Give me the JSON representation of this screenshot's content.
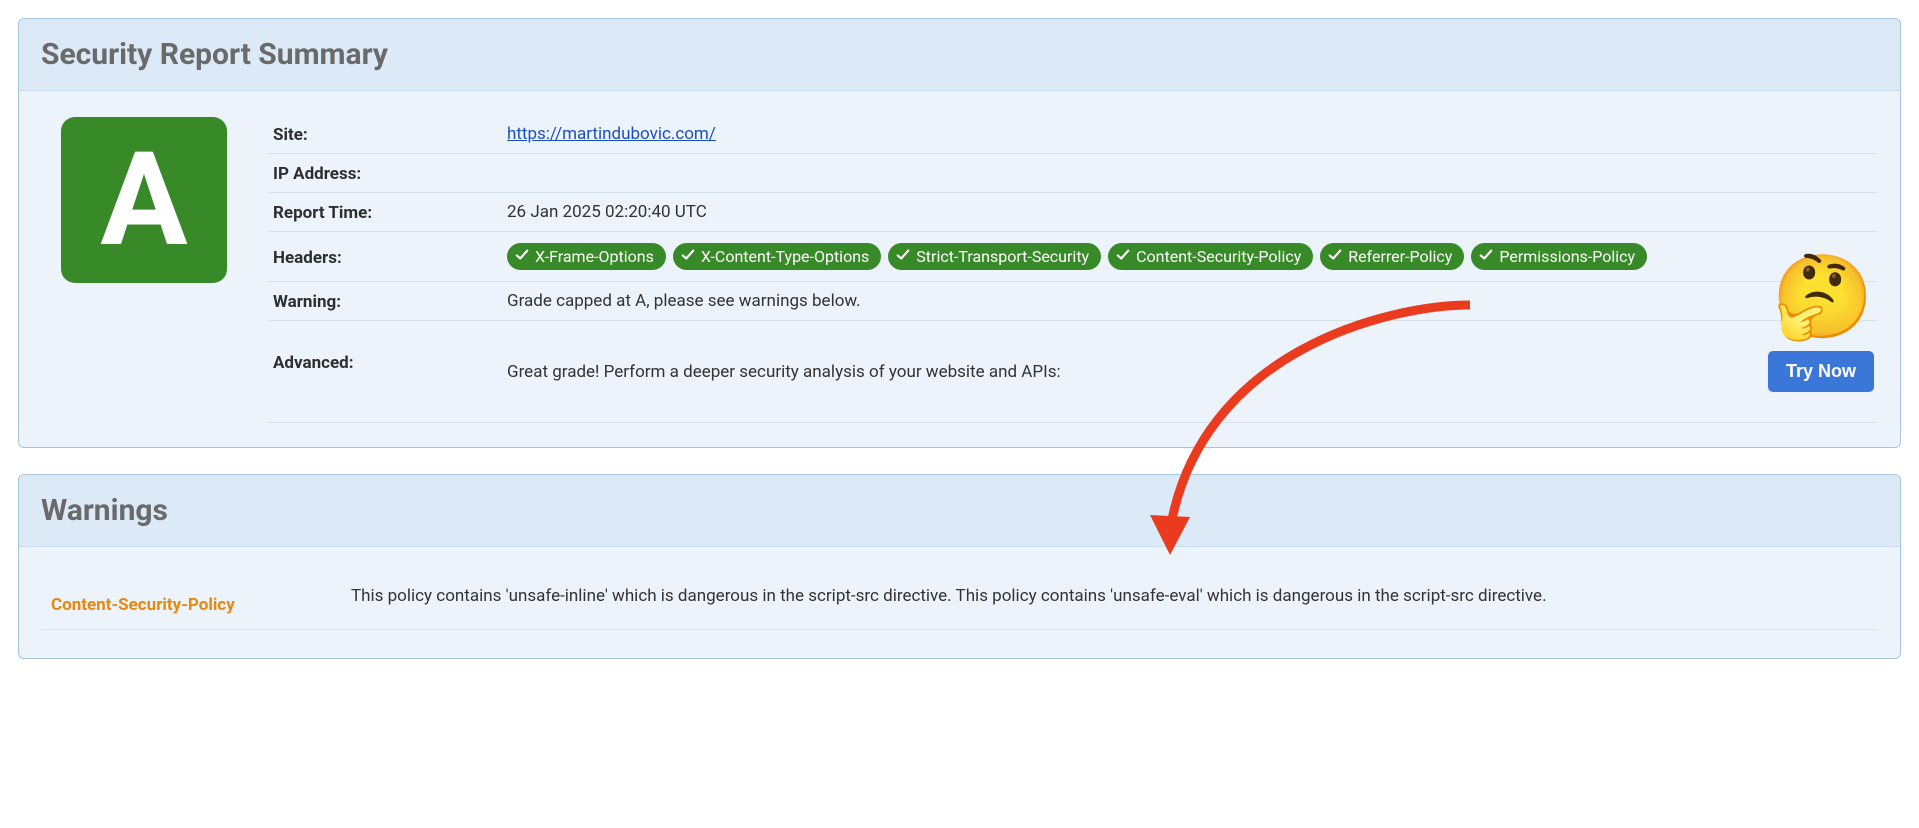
{
  "summary": {
    "title": "Security Report Summary",
    "grade": "A",
    "rows": {
      "site_label": "Site:",
      "site_url": "https://martindubovic.com/",
      "ip_label": "IP Address:",
      "ip_value": "",
      "report_time_label": "Report Time:",
      "report_time_value": "26 Jan 2025 02:20:40 UTC",
      "headers_label": "Headers:",
      "headers": [
        "X-Frame-Options",
        "X-Content-Type-Options",
        "Strict-Transport-Security",
        "Content-Security-Policy",
        "Referrer-Policy",
        "Permissions-Policy"
      ],
      "warning_label": "Warning:",
      "warning_text": "Grade capped at A, please see warnings below.",
      "advanced_label": "Advanced:",
      "advanced_text": "Great grade! Perform a deeper security analysis of your website and APIs:",
      "try_now_label": "Try Now"
    }
  },
  "warnings": {
    "title": "Warnings",
    "items": [
      {
        "name": "Content-Security-Policy",
        "text": "This policy contains 'unsafe-inline' which is dangerous in the script-src directive. This policy contains 'unsafe-eval' which is dangerous in the script-src directive."
      }
    ]
  },
  "annotation": {
    "emoji": "🤔"
  },
  "colors": {
    "grade_bg": "#388a28",
    "pill_bg": "#388a28",
    "link": "#1a4fbf",
    "button": "#3b77d8",
    "warning_label": "#e8890f",
    "arrow": "#eb3b1f"
  }
}
